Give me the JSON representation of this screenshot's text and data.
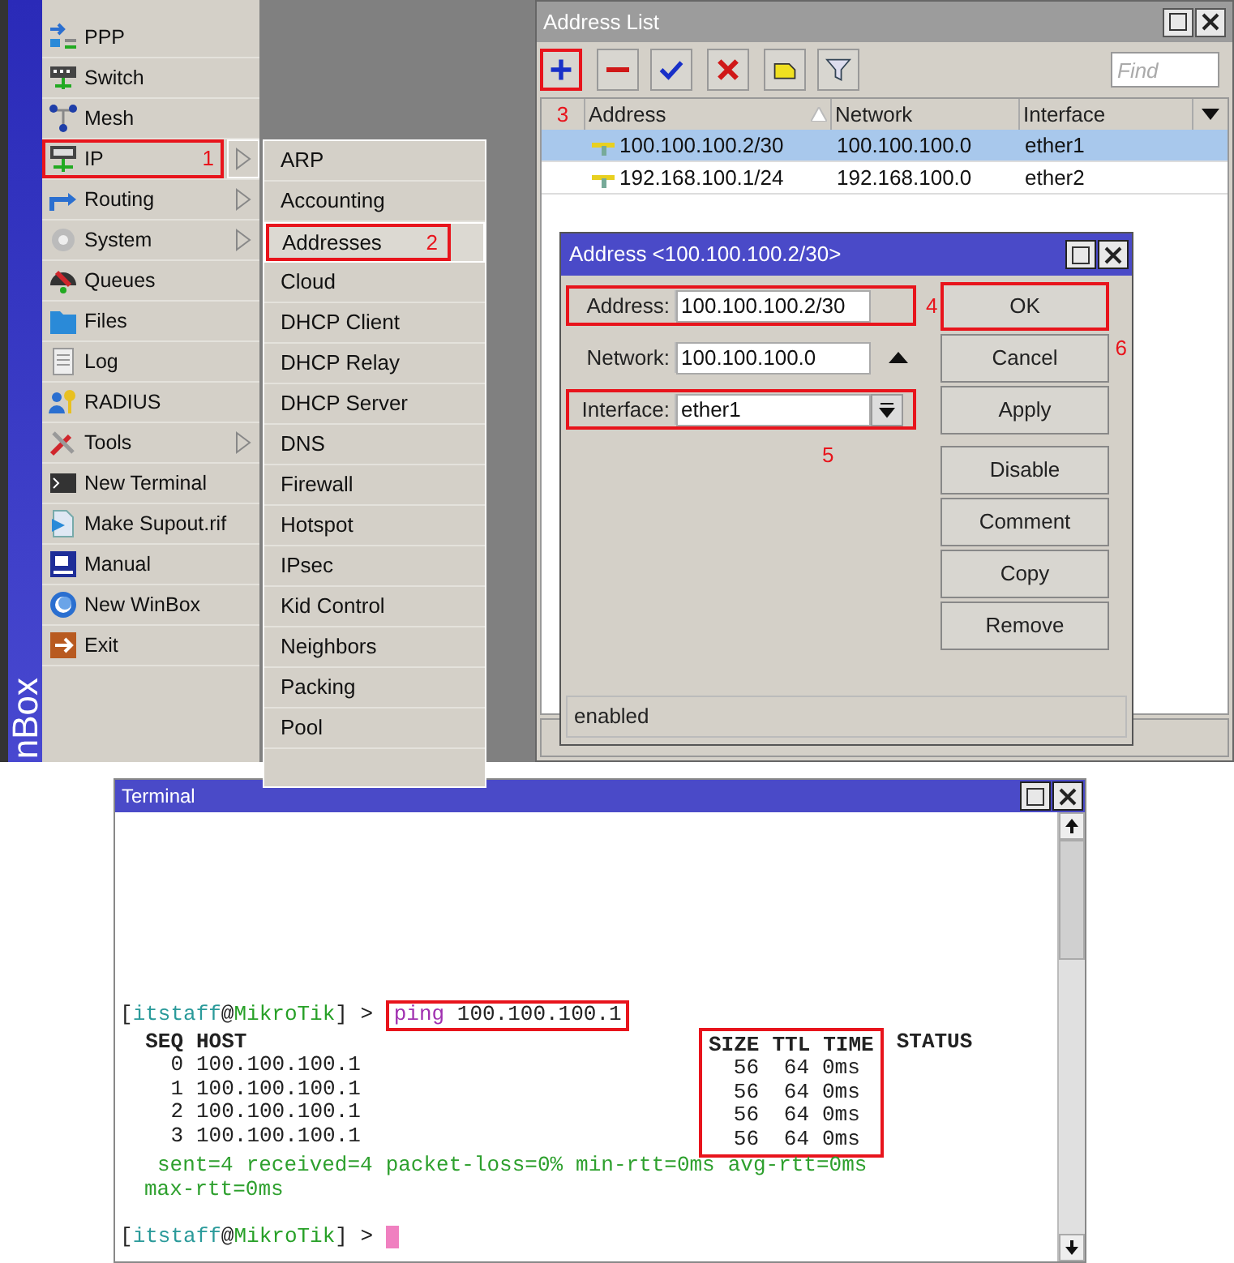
{
  "desktop": {
    "brand": "nBox"
  },
  "menu": {
    "items": [
      {
        "label": "PPP",
        "submenu": false,
        "selected": false,
        "highlighted": false
      },
      {
        "label": "Switch",
        "submenu": false,
        "selected": false,
        "highlighted": false
      },
      {
        "label": "Mesh",
        "submenu": false,
        "selected": false,
        "highlighted": false
      },
      {
        "label": "IP",
        "submenu": true,
        "selected": true,
        "highlighted": true,
        "marker": "1"
      },
      {
        "label": "Routing",
        "submenu": true,
        "selected": false,
        "highlighted": false
      },
      {
        "label": "System",
        "submenu": true,
        "selected": false,
        "highlighted": false
      },
      {
        "label": "Queues",
        "submenu": false,
        "selected": false,
        "highlighted": false
      },
      {
        "label": "Files",
        "submenu": false,
        "selected": false,
        "highlighted": false
      },
      {
        "label": "Log",
        "submenu": false,
        "selected": false,
        "highlighted": false
      },
      {
        "label": "RADIUS",
        "submenu": false,
        "selected": false,
        "highlighted": false
      },
      {
        "label": "Tools",
        "submenu": true,
        "selected": false,
        "highlighted": false
      },
      {
        "label": "New Terminal",
        "submenu": false,
        "selected": false,
        "highlighted": false
      },
      {
        "label": "Make Supout.rif",
        "submenu": false,
        "selected": false,
        "highlighted": false
      },
      {
        "label": "Manual",
        "submenu": false,
        "selected": false,
        "highlighted": false
      },
      {
        "label": "New WinBox",
        "submenu": false,
        "selected": false,
        "highlighted": false
      },
      {
        "label": "Exit",
        "submenu": false,
        "selected": false,
        "highlighted": false
      }
    ]
  },
  "submenu": {
    "items": [
      {
        "label": "ARP",
        "selected": false,
        "highlighted": false
      },
      {
        "label": "Accounting",
        "selected": false,
        "highlighted": false
      },
      {
        "label": "Addresses",
        "selected": true,
        "highlighted": true,
        "marker": "2"
      },
      {
        "label": "Cloud",
        "selected": false,
        "highlighted": false
      },
      {
        "label": "DHCP Client",
        "selected": false,
        "highlighted": false
      },
      {
        "label": "DHCP Relay",
        "selected": false,
        "highlighted": false
      },
      {
        "label": "DHCP Server",
        "selected": false,
        "highlighted": false
      },
      {
        "label": "DNS",
        "selected": false,
        "highlighted": false
      },
      {
        "label": "Firewall",
        "selected": false,
        "highlighted": false
      },
      {
        "label": "Hotspot",
        "selected": false,
        "highlighted": false
      },
      {
        "label": "IPsec",
        "selected": false,
        "highlighted": false
      },
      {
        "label": "Kid Control",
        "selected": false,
        "highlighted": false
      },
      {
        "label": "Neighbors",
        "selected": false,
        "highlighted": false
      },
      {
        "label": "Packing",
        "selected": false,
        "highlighted": false
      },
      {
        "label": "Pool",
        "selected": false,
        "highlighted": false
      }
    ]
  },
  "address_list": {
    "title": "Address List",
    "toolbar": [
      {
        "highlighted": true
      },
      {
        "highlighted": false
      },
      {
        "highlighted": false
      },
      {
        "highlighted": false
      },
      {
        "highlighted": false
      },
      {
        "highlighted": false
      }
    ],
    "find": {
      "placeholder": "Find"
    },
    "marker": "3",
    "columns": [
      "Address",
      "Network",
      "Interface"
    ],
    "rows": [
      {
        "address": "100.100.100.2/30",
        "network": "100.100.100.0",
        "interface": "ether1",
        "selected": true
      },
      {
        "address": "192.168.100.1/24",
        "network": "192.168.100.0",
        "interface": "ether2",
        "selected": false
      }
    ]
  },
  "address_dialog": {
    "title": "Address <100.100.100.2/30>",
    "fields": [
      {
        "kind": "text",
        "label": "Address:",
        "value": "100.100.100.2/30",
        "highlighted": true,
        "marker": "4"
      },
      {
        "kind": "network",
        "label": "Network:",
        "value": "100.100.100.0",
        "highlighted": false
      },
      {
        "kind": "select",
        "label": "Interface:",
        "value": "ether1",
        "highlighted": true,
        "marker": "5"
      }
    ],
    "buttons": [
      {
        "label": "OK",
        "highlighted": true,
        "marker": "6"
      },
      {
        "label": "Cancel",
        "highlighted": false
      },
      {
        "label": "Apply",
        "highlighted": false
      },
      {
        "label": "Disable",
        "highlighted": false
      },
      {
        "label": "Comment",
        "highlighted": false
      },
      {
        "label": "Copy",
        "highlighted": false
      },
      {
        "label": "Remove",
        "highlighted": false
      }
    ],
    "status": "enabled"
  },
  "terminal": {
    "title": "Terminal",
    "command_line": {
      "prompt": [
        {
          "text": "[",
          "kind": "plain"
        },
        {
          "text": "itstaff",
          "kind": "user"
        },
        {
          "text": "@",
          "kind": "plain"
        },
        {
          "text": "MikroTik",
          "kind": "host"
        },
        {
          "text": "] >",
          "kind": "plain"
        }
      ],
      "command": "ping",
      "argument": "100.100.100.1",
      "highlighted": true
    },
    "ping_table": {
      "columns": [
        "SEQ",
        "HOST",
        "SIZE",
        "TTL",
        "TIME",
        "STATUS"
      ],
      "highlighted": true,
      "rows": [
        {
          "seq": "0",
          "host": "100.100.100.1",
          "size": "56",
          "ttl": "64",
          "time": "0ms"
        },
        {
          "seq": "1",
          "host": "100.100.100.1",
          "size": "56",
          "ttl": "64",
          "time": "0ms"
        },
        {
          "seq": "2",
          "host": "100.100.100.1",
          "size": "56",
          "ttl": "64",
          "time": "0ms"
        },
        {
          "seq": "3",
          "host": "100.100.100.1",
          "size": "56",
          "ttl": "64",
          "time": "0ms"
        }
      ]
    },
    "summary": [
      [
        "sent=4",
        "received=4",
        "packet-loss=0%",
        "min-rtt=0ms",
        "avg-rtt=0ms"
      ],
      [
        "max-rtt=0ms"
      ]
    ],
    "prompt": [
      {
        "text": "[",
        "kind": "plain"
      },
      {
        "text": "itstaff",
        "kind": "user"
      },
      {
        "text": "@",
        "kind": "plain"
      },
      {
        "text": "MikroTik",
        "kind": "host"
      },
      {
        "text": "] >",
        "kind": "plain"
      }
    ]
  }
}
